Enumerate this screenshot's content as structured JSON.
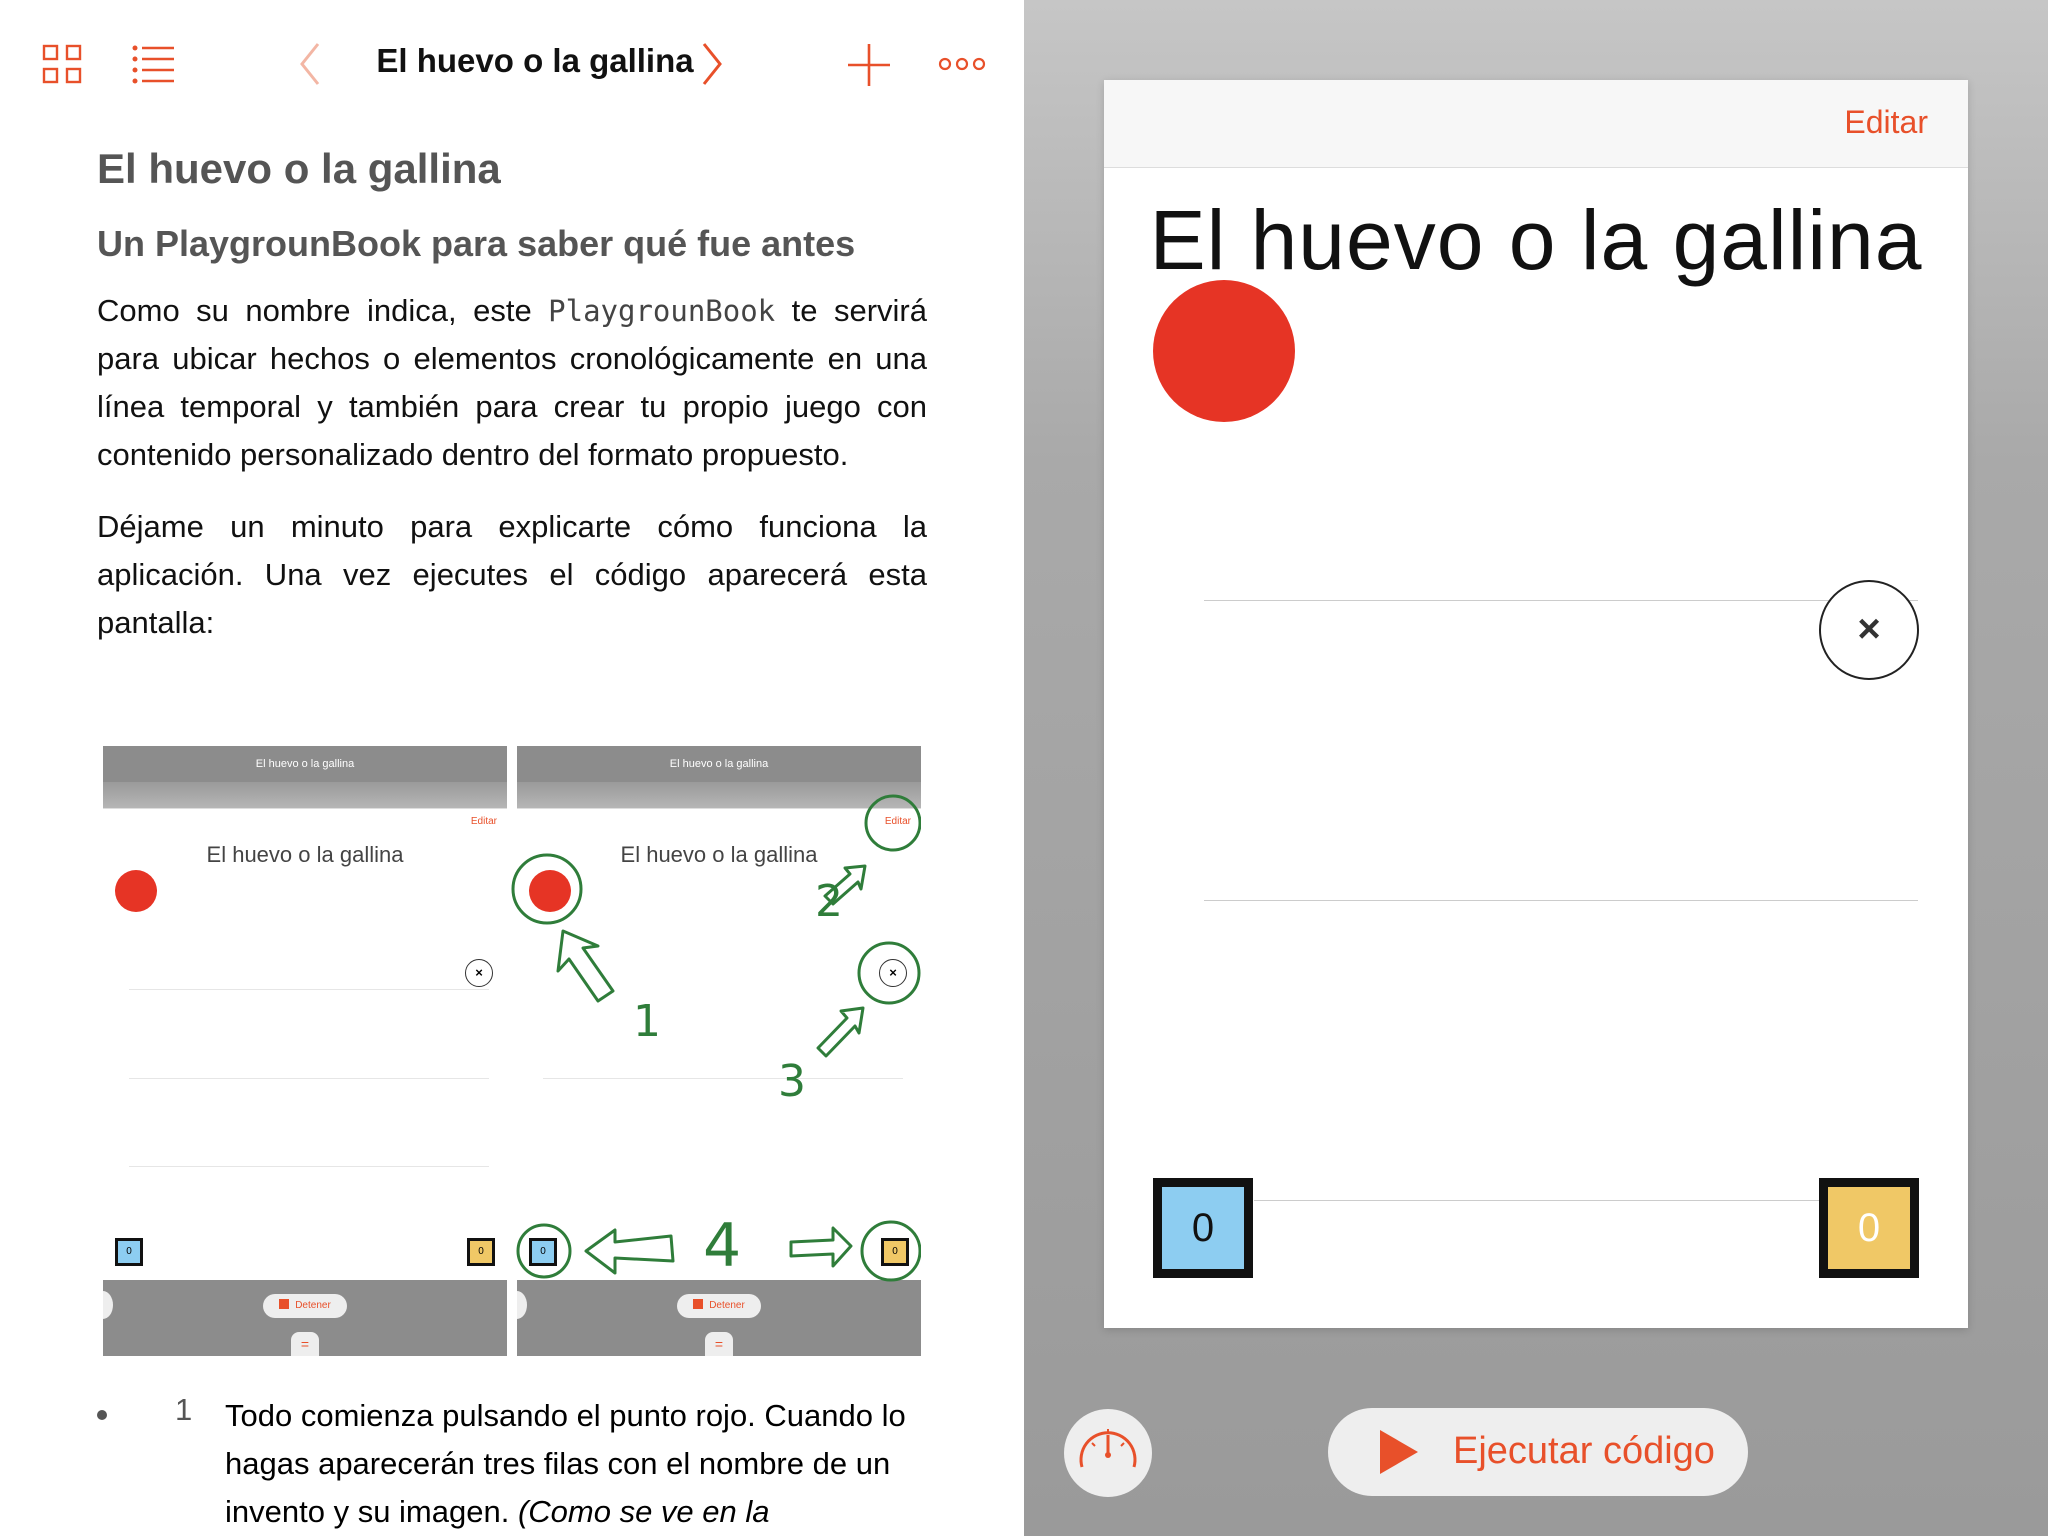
{
  "nav": {
    "title": "El huevo o la gallina"
  },
  "doc": {
    "heading": "El huevo o la gallina",
    "subheading": "Un PlaygrounBook para saber qué fue antes",
    "p1_before": "Como su nombre indica, este ",
    "p1_code": "PlaygrounBook",
    "p1_after": " te servirá para ubicar hechos o elementos cronológicamente en una línea temporal y también para crear tu propio juego con contenido personalizado dentro del formato propuesto.",
    "p2": "Déjame un minuto para explicarte cómo funciona la aplicación. Una vez ejecutes el código aparecerá esta pantalla:"
  },
  "figure": {
    "bar_title": "El huevo o la gallina",
    "edit_label": "Editar",
    "title": "El huevo o la gallina",
    "close_glyph": "×",
    "score_blue": "0",
    "score_yellow": "0",
    "stop_label": "Detener",
    "eq_glyph": "=",
    "annotations": [
      "1",
      "2",
      "3",
      "4"
    ]
  },
  "list": {
    "number": "1",
    "text_plain": "Todo comienza pulsando el punto rojo. Cuando lo hagas aparecerán tres filas con el nombre de un invento y su imagen. ",
    "text_italic": "(Como se ve en la"
  },
  "live_view": {
    "edit_label": "Editar",
    "title": "El huevo o la gallina",
    "close_glyph": "×",
    "score_blue": "0",
    "score_yellow": "0",
    "run_label": "Ejecutar código"
  },
  "colors": {
    "accent": "#e8502a",
    "red_dot": "#e63425",
    "score_blue": "#8dcdf1",
    "score_yellow": "#f0c866",
    "annotation_green": "#2f7d3a"
  },
  "icons": [
    "grid-icon",
    "list-icon",
    "chevron-left-icon",
    "chevron-right-icon",
    "plus-icon",
    "more-icon",
    "speedometer-icon",
    "play-icon",
    "close-icon"
  ]
}
